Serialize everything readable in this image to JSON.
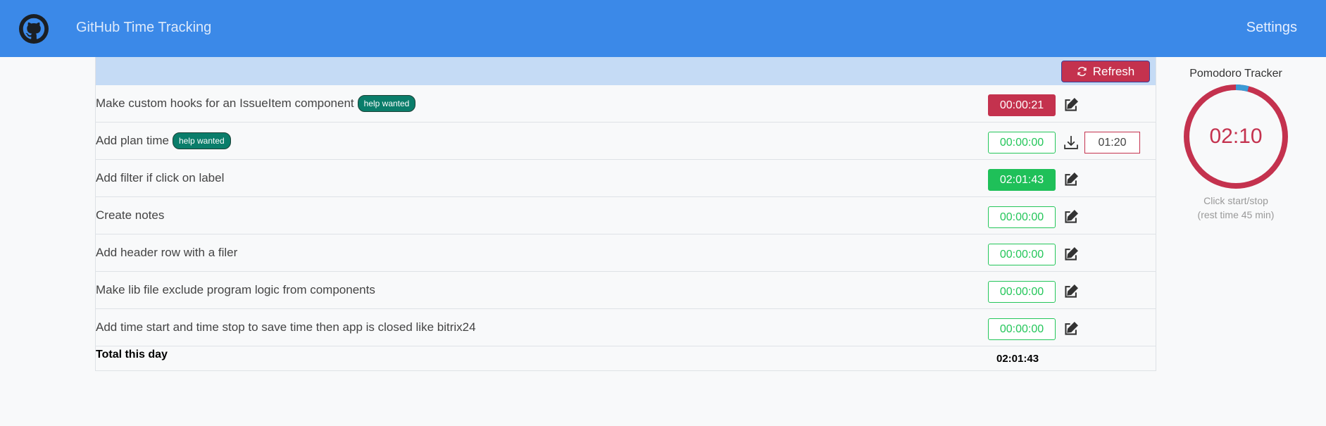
{
  "app": {
    "title": "GitHub Time Tracking",
    "settings_label": "Settings"
  },
  "toolbar": {
    "refresh_label": "Refresh"
  },
  "issues": [
    {
      "title": "Make custom hooks for an IssueItem component",
      "badge": "help wanted",
      "time": "00:00:21",
      "state": "running",
      "action_icon": "edit-icon"
    },
    {
      "title": "Add plan time",
      "badge": "help wanted",
      "time": "00:00:00",
      "state": "idle",
      "action_icon": "download-icon",
      "plan_time": "01:20"
    },
    {
      "title": "Add filter if click on label",
      "time": "02:01:43",
      "state": "done",
      "action_icon": "edit-icon"
    },
    {
      "title": "Create notes",
      "time": "00:00:00",
      "state": "idle",
      "action_icon": "edit-icon"
    },
    {
      "title": "Add header row with a filer",
      "time": "00:00:00",
      "state": "idle",
      "action_icon": "edit-icon"
    },
    {
      "title": "Make lib file exclude program logic from components",
      "time": "00:00:00",
      "state": "idle",
      "action_icon": "edit-icon"
    },
    {
      "title": "Add time start and time stop to save time then app is closed like bitrix24",
      "time": "00:00:00",
      "state": "idle",
      "action_icon": "edit-icon"
    }
  ],
  "total": {
    "label": "Total this day",
    "value": "02:01:43"
  },
  "pomodoro": {
    "title": "Pomodoro Tracker",
    "time": "02:10",
    "hint_line1": "Click start/stop",
    "hint_line2": "(rest time 45 min)",
    "progress_fraction": 0.04,
    "ring_color": "#c4324e",
    "progress_color": "#3b9bd6"
  },
  "colors": {
    "navbar": "#3b89e8",
    "accent_red": "#c4324e",
    "accent_green": "#24c65a",
    "badge": "#0a7d6a"
  }
}
